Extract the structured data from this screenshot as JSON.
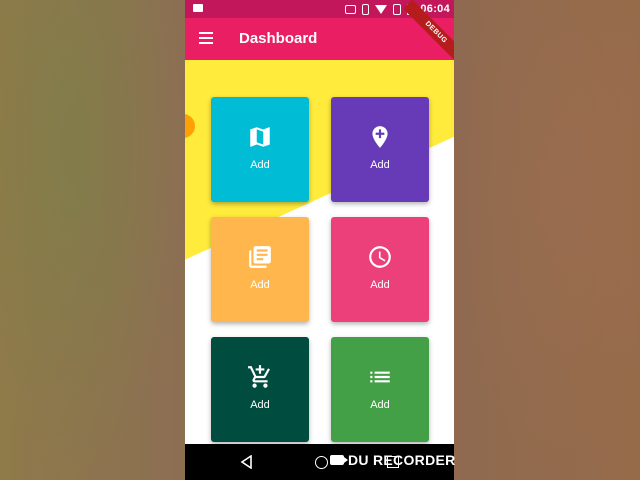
{
  "status_bar": {
    "time": "06:04",
    "icons": [
      "record-icon",
      "cast-icon",
      "vibrate-icon",
      "wifi-icon",
      "no-sim-icon",
      "battery-icon"
    ]
  },
  "app_bar": {
    "title": "Dashboard",
    "menu_icon": "menu-icon",
    "debug_banner": "DEBUG"
  },
  "cards": [
    {
      "label": "Add",
      "icon": "map-icon",
      "color": "#00bcd4"
    },
    {
      "label": "Add",
      "icon": "add-location-icon",
      "color": "#673ab7"
    },
    {
      "label": "Add",
      "icon": "library-books-icon",
      "color": "#ffb74d"
    },
    {
      "label": "Add",
      "icon": "clock-icon",
      "color": "#ec407a"
    },
    {
      "label": "Add",
      "icon": "add-shopping-cart-icon",
      "color": "#004d40"
    },
    {
      "label": "Add",
      "icon": "list-icon",
      "color": "#43a047"
    }
  ],
  "nav_bar": {
    "icons": [
      "back-icon",
      "home-icon",
      "recent-apps-icon"
    ]
  },
  "watermark": {
    "text": "DU RECORDER"
  },
  "colors": {
    "status_bar": "#c2185b",
    "app_bar": "#e91e63",
    "background_yellow": "#ffeb3b"
  }
}
